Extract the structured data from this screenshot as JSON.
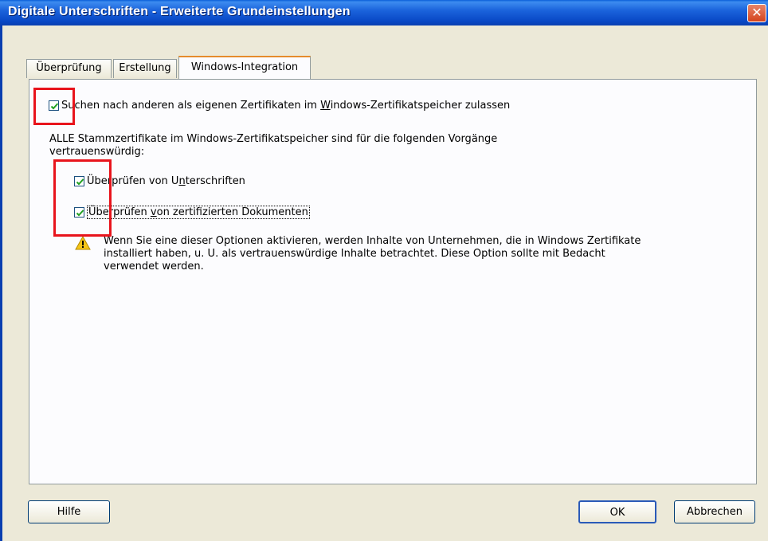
{
  "window": {
    "title": "Digitale Unterschriften - Erweiterte Grundeinstellungen",
    "close_glyph": "✕"
  },
  "tabs": [
    {
      "label": "Überprüfung"
    },
    {
      "label": "Erstellung"
    },
    {
      "label": "Windows-Integration"
    }
  ],
  "panel": {
    "search_option": {
      "label_pre": "Suchen nach anderen als eigenen Zertifikaten im ",
      "label_underline": "W",
      "label_post": "indows-Zertifikatspeicher zulassen",
      "checked": true
    },
    "trust_description": "ALLE Stammzertifikate im Windows-Zertifikatspeicher sind für die folgenden Vorgänge vertrauenswürdig:",
    "verify_signatures": {
      "label_pre": "Überprüfen von U",
      "label_underline": "n",
      "label_post": "terschriften",
      "checked": true
    },
    "verify_certified": {
      "label_pre": "Überprüfen ",
      "label_underline": "v",
      "label_post": "on zertifizierten Dokumenten",
      "checked": true
    },
    "warning_text": "Wenn Sie eine dieser Optionen aktivieren, werden Inhalte von Unternehmen, die in Windows Zertifikate installiert haben, u. U. als vertrauenswürdige Inhalte betrachtet. Diese Option sollte mit Bedacht verwendet werden."
  },
  "buttons": {
    "help": "Hilfe",
    "ok": "OK",
    "cancel": "Abbrechen"
  },
  "colors": {
    "title_bar": "#0a5fd8",
    "highlight_box": "#e8141c",
    "checkmark": "#21a121",
    "warning": "#f5c518"
  }
}
